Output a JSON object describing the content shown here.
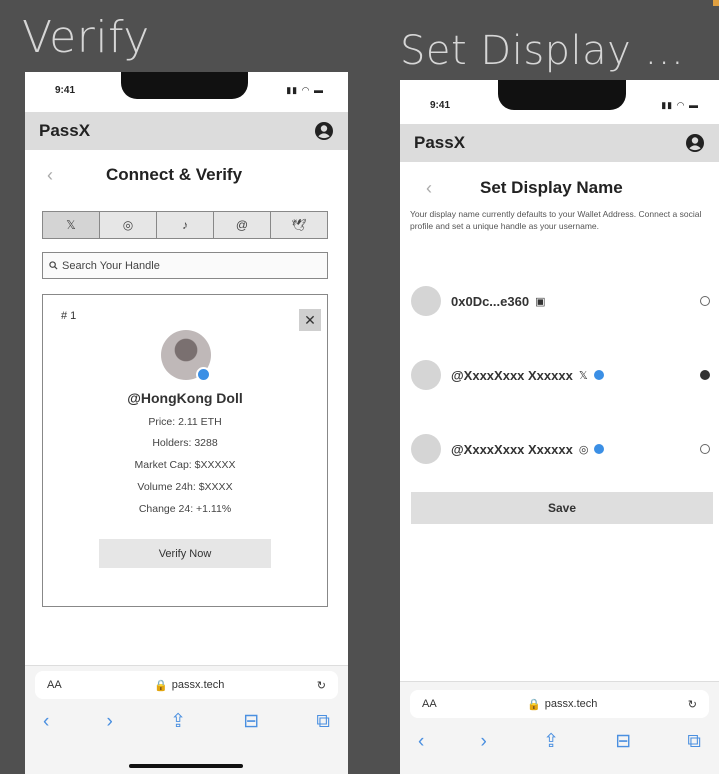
{
  "frames": {
    "left_title": "Verify",
    "right_title": "Set Display ..."
  },
  "status_bar": {
    "time": "9:41",
    "icons": "▮▮ ◠ ▬"
  },
  "app": {
    "name": "PassX"
  },
  "verify": {
    "title": "Connect & Verify",
    "back": "‹",
    "tabs": [
      {
        "icon": "x-icon",
        "glyph": "𝕏"
      },
      {
        "icon": "instagram-icon",
        "glyph": "◎"
      },
      {
        "icon": "tiktok-icon",
        "glyph": "♪"
      },
      {
        "icon": "threads-icon",
        "glyph": "@"
      },
      {
        "icon": "bird-icon",
        "glyph": "🕊"
      }
    ],
    "search_placeholder": "Search Your Handle",
    "card": {
      "rank": "# 1",
      "close": "✕",
      "handle": "@HongKong Doll",
      "price": "Price: 2.11 ETH",
      "holders": "Holders: 3288",
      "market_cap": "Market Cap: $XXXXX",
      "volume": "Volume 24h: $XXXX",
      "change": "Change 24: +1.11%",
      "verify_button": "Verify Now"
    }
  },
  "display_name": {
    "title": "Set Display Name",
    "back": "‹",
    "description": "Your display name currently defaults to your Wallet Address. Connect a social profile and set a unique handle as your username.",
    "options": [
      {
        "label": "0x0Dc...e360",
        "icon": "wallet-icon",
        "glyph": "▣",
        "verified": false,
        "selected": false
      },
      {
        "label": "@XxxxXxxx Xxxxxx",
        "icon": "x-icon",
        "glyph": "𝕏",
        "verified": true,
        "selected": true
      },
      {
        "label": "@XxxxXxxx Xxxxxx",
        "icon": "instagram-icon",
        "glyph": "◎",
        "verified": true,
        "selected": false
      }
    ],
    "save_button": "Save"
  },
  "browser": {
    "text_size": "AA",
    "url": "passx.tech",
    "reload": "↻",
    "nav": [
      "‹",
      "›",
      "⇪",
      "⊟",
      "⧉"
    ]
  },
  "colors": {
    "verified": "#3b8fe5",
    "nav_blue": "#4a8fe0",
    "appbar": "#dcdcdc"
  }
}
